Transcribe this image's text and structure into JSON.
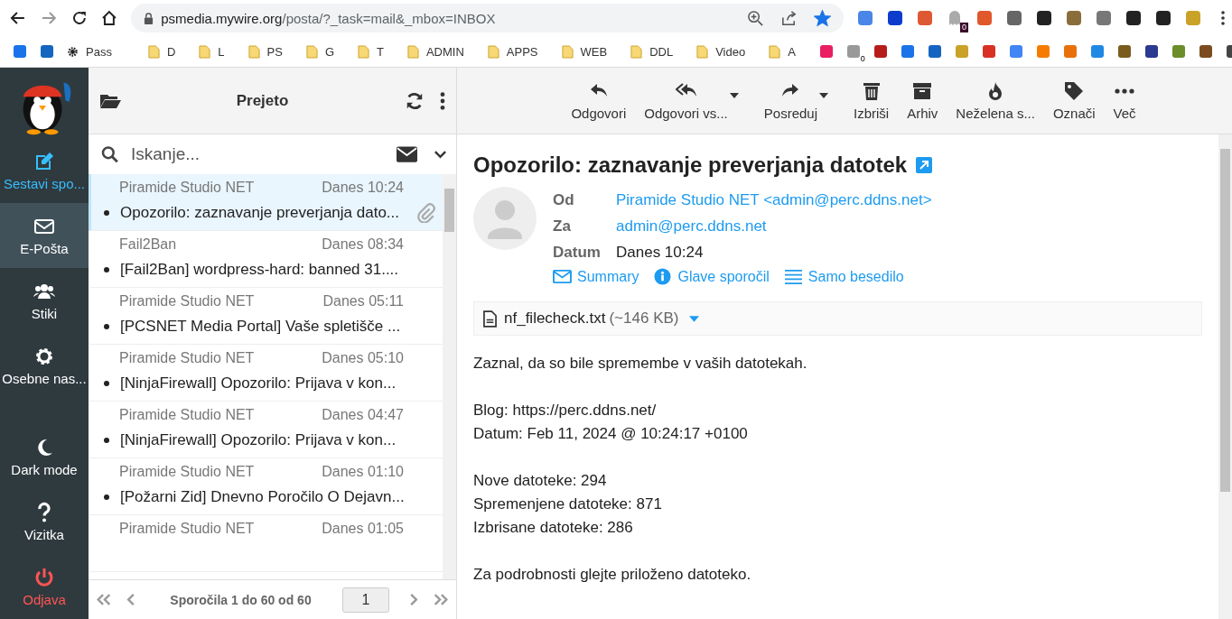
{
  "browser": {
    "url_host": "psmedia.mywire.org",
    "url_path": "/posta/?_task=mail&_mbox=INBOX",
    "bookmarked": true,
    "extension_badge": "0",
    "bookmarks": [
      {
        "kind": "site"
      },
      {
        "kind": "site"
      },
      {
        "kind": "gear",
        "label": "Pass"
      },
      {
        "kind": "puzzle"
      },
      {
        "kind": "folder",
        "label": "D"
      },
      {
        "kind": "folder",
        "label": "L"
      },
      {
        "kind": "folder",
        "label": "PS"
      },
      {
        "kind": "folder",
        "label": "G"
      },
      {
        "kind": "folder",
        "label": "T"
      },
      {
        "kind": "folder",
        "label": "ADMIN"
      },
      {
        "kind": "folder",
        "label": "APPS"
      },
      {
        "kind": "folder",
        "label": "WEB"
      },
      {
        "kind": "folder",
        "label": "DDL"
      },
      {
        "kind": "folder",
        "label": "Video"
      },
      {
        "kind": "folder",
        "label": "A"
      },
      {
        "kind": "site"
      },
      {
        "kind": "site",
        "badge": "0"
      },
      {
        "kind": "site"
      },
      {
        "kind": "site"
      },
      {
        "kind": "site"
      },
      {
        "kind": "site"
      },
      {
        "kind": "site"
      },
      {
        "kind": "site"
      },
      {
        "kind": "site"
      },
      {
        "kind": "site"
      },
      {
        "kind": "site"
      },
      {
        "kind": "site"
      },
      {
        "kind": "site"
      },
      {
        "kind": "site"
      },
      {
        "kind": "site"
      },
      {
        "kind": "site"
      }
    ]
  },
  "nav": [
    {
      "kind": "compose",
      "label": "Sestavi spo...",
      "selected": false
    },
    {
      "kind": "mail",
      "label": "E-Pošta",
      "selected": true
    },
    {
      "kind": "contacts",
      "label": "Stiki",
      "selected": false
    },
    {
      "kind": "settings",
      "label": "Osebne nas...",
      "selected": false
    },
    {
      "kind": "darkmode",
      "label": "Dark mode",
      "selected": false
    },
    {
      "kind": "about",
      "label": "Vizitka",
      "selected": false
    },
    {
      "kind": "logout",
      "label": "Odjava",
      "selected": false
    }
  ],
  "list": {
    "title": "Prejeto",
    "search_placeholder": "Iskanje...",
    "messages": [
      {
        "sender": "Piramide Studio NET",
        "date": "Danes 10:24",
        "subject": "Opozorilo: zaznavanje preverjanja dato...",
        "unread": true,
        "attachment": true,
        "selected": true
      },
      {
        "sender": "Fail2Ban",
        "date": "Danes 08:34",
        "subject": "[Fail2Ban] wordpress-hard: banned 31....",
        "unread": true,
        "attachment": false,
        "selected": false
      },
      {
        "sender": "Piramide Studio NET",
        "date": "Danes 05:11",
        "subject": "[PCSNET Media Portal] Vaše spletišče ...",
        "unread": true,
        "attachment": false,
        "selected": false
      },
      {
        "sender": "Piramide Studio NET",
        "date": "Danes 05:10",
        "subject": "[NinjaFirewall] Opozorilo: Prijava v kon...",
        "unread": true,
        "attachment": false,
        "selected": false
      },
      {
        "sender": "Piramide Studio NET",
        "date": "Danes 04:47",
        "subject": "[NinjaFirewall] Opozorilo: Prijava v kon...",
        "unread": true,
        "attachment": false,
        "selected": false
      },
      {
        "sender": "Piramide Studio NET",
        "date": "Danes 01:10",
        "subject": "[Požarni Zid] Dnevno Poročilo O Dejavn...",
        "unread": true,
        "attachment": false,
        "selected": false
      },
      {
        "sender": "Piramide Studio NET",
        "date": "Danes 01:05",
        "selected": false
      }
    ],
    "pagination": "Sporočila 1 do 60 od 60",
    "page": "1"
  },
  "toolbar": [
    {
      "kind": "reply",
      "label": "Odgovori",
      "menu": false
    },
    {
      "kind": "replyall",
      "label": "Odgovori vs...",
      "menu": true
    },
    {
      "kind": "forward",
      "label": "Posreduj",
      "menu": true
    },
    {
      "kind": "delete",
      "label": "Izbriši",
      "menu": false
    },
    {
      "kind": "archive",
      "label": "Arhiv",
      "menu": false
    },
    {
      "kind": "junk",
      "label": "Neželena s...",
      "menu": false
    },
    {
      "kind": "tag",
      "label": "Označi",
      "menu": false
    },
    {
      "kind": "more",
      "label": "Več",
      "menu": false
    }
  ],
  "message": {
    "subject": "Opozorilo: zaznavanje preverjanja datotek",
    "headers": [
      {
        "label": "Od",
        "value": "Piramide Studio NET <admin@perc.ddns.net>",
        "link": true
      },
      {
        "label": "Za",
        "value": "admin@perc.ddns.net",
        "link": true
      },
      {
        "label": "Datum",
        "value": "Danes 10:24",
        "link": false
      }
    ],
    "views": [
      {
        "kind": "envelope",
        "label": "Summary"
      },
      {
        "kind": "info",
        "label": "Glave sporočil"
      },
      {
        "kind": "lines",
        "label": "Samo besedilo"
      }
    ],
    "attachment": {
      "name": "nf_filecheck.txt",
      "size": "(~146 KB)"
    },
    "body": [
      [
        "Zaznal, da so bile spremembe v vaših datotekah."
      ],
      [
        "Blog: https://perc.ddns.net/",
        "Datum: Feb 11, 2024 @ 10:24:17 +0100"
      ],
      [
        "Nove datoteke: 294",
        "Spremenjene datoteke: 871",
        "Izbrisane datoteke: 286"
      ],
      [
        "Za podrobnosti glejte priloženo datoteko."
      ]
    ]
  }
}
